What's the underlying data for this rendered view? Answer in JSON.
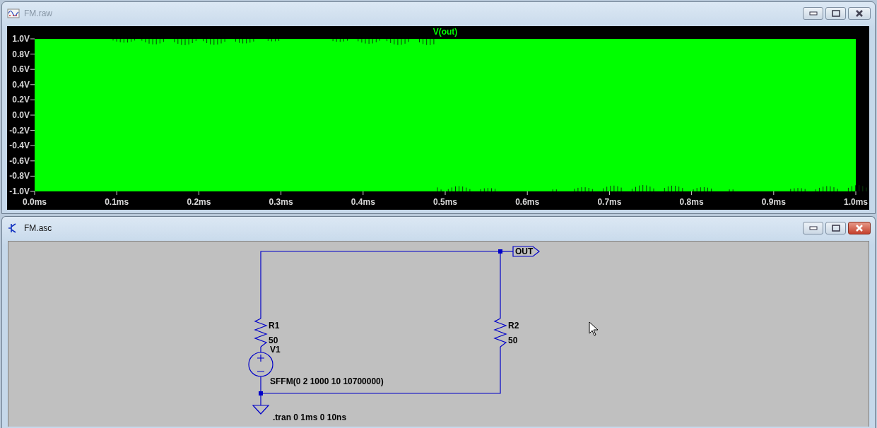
{
  "windows": [
    {
      "kind": "waveform",
      "title": "FM.raw",
      "active": false,
      "trace": "V(out)",
      "y_tick_labels": [
        "1.0V",
        "0.8V",
        "0.6V",
        "0.4V",
        "0.2V",
        "0.0V",
        "-0.2V",
        "-0.4V",
        "-0.6V",
        "-0.8V",
        "-1.0V"
      ],
      "x_tick_labels": [
        "0.0ms",
        "0.1ms",
        "0.2ms",
        "0.3ms",
        "0.4ms",
        "0.5ms",
        "0.6ms",
        "0.7ms",
        "0.8ms",
        "0.9ms",
        "1.0ms"
      ]
    },
    {
      "kind": "schematic",
      "title": "FM.asc",
      "active": true,
      "components": [
        {
          "kind": "resistor",
          "ref": "R1",
          "value": "50"
        },
        {
          "kind": "voltage_source",
          "ref": "V1",
          "value": "SFFM(0 2 1000 10 10700000)"
        },
        {
          "kind": "resistor",
          "ref": "R2",
          "value": "50"
        }
      ],
      "net_label": "OUT",
      "directive": ".tran 0 1ms 0 10ns"
    }
  ]
}
